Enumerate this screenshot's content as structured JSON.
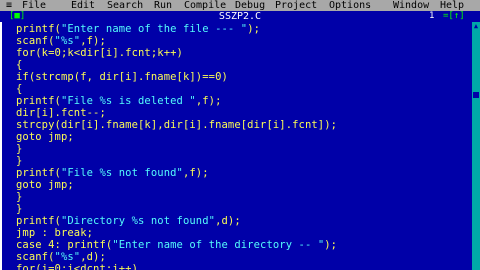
{
  "menu": {
    "system": "≡",
    "items": [
      "File",
      "Edit",
      "Search",
      "Run",
      "Compile",
      "Debug",
      "Project",
      "Options",
      "Window",
      "Help"
    ]
  },
  "window": {
    "close_glyph": "[■]",
    "title": "SSZP2.C",
    "number": "1",
    "resize_glyph": "=[↑]"
  },
  "code_lines": [
    [
      "printf(",
      "\"Enter name of the file --- \"",
      ");"
    ],
    [
      "scanf(",
      "\"%s\"",
      ",f);"
    ],
    [
      "for(k=0;k<dir[i].fcnt;k++)",
      "",
      ""
    ],
    [
      "{",
      "",
      ""
    ],
    [
      "if(strcmp(f, dir[i].fname[k])==0)",
      "",
      ""
    ],
    [
      "{",
      "",
      ""
    ],
    [
      "printf(",
      "\"File %s is deleted \"",
      ",f);"
    ],
    [
      "dir[i].fcnt--;",
      "",
      ""
    ],
    [
      "strcpy(dir[i].fname[k],dir[i].fname[dir[i].fcnt]);",
      "",
      ""
    ],
    [
      "goto jmp;",
      "",
      ""
    ],
    [
      "}",
      "",
      ""
    ],
    [
      "}",
      "",
      ""
    ],
    [
      "printf(",
      "\"File %s not found\"",
      ",f);"
    ],
    [
      "goto jmp;",
      "",
      ""
    ],
    [
      "}",
      "",
      ""
    ],
    [
      "}",
      "",
      ""
    ],
    [
      "printf(",
      "\"Directory %s not found\"",
      ",d);"
    ],
    [
      "jmp : break;",
      "",
      ""
    ],
    [
      "case 4: printf(",
      "\"Enter name of the directory -- \"",
      ");"
    ],
    [
      "scanf(",
      "\"%s\"",
      ",d);"
    ],
    [
      "for(i=0;i<dcnt;i++)",
      "",
      ""
    ]
  ],
  "scrollbar": {
    "up_arrow": "▲"
  },
  "colors": {
    "background": "#0000a8",
    "code_text": "#fcfc54",
    "string_text": "#54fcfc",
    "menubar": "#a8a8a8",
    "hotkey": "#a80000"
  }
}
